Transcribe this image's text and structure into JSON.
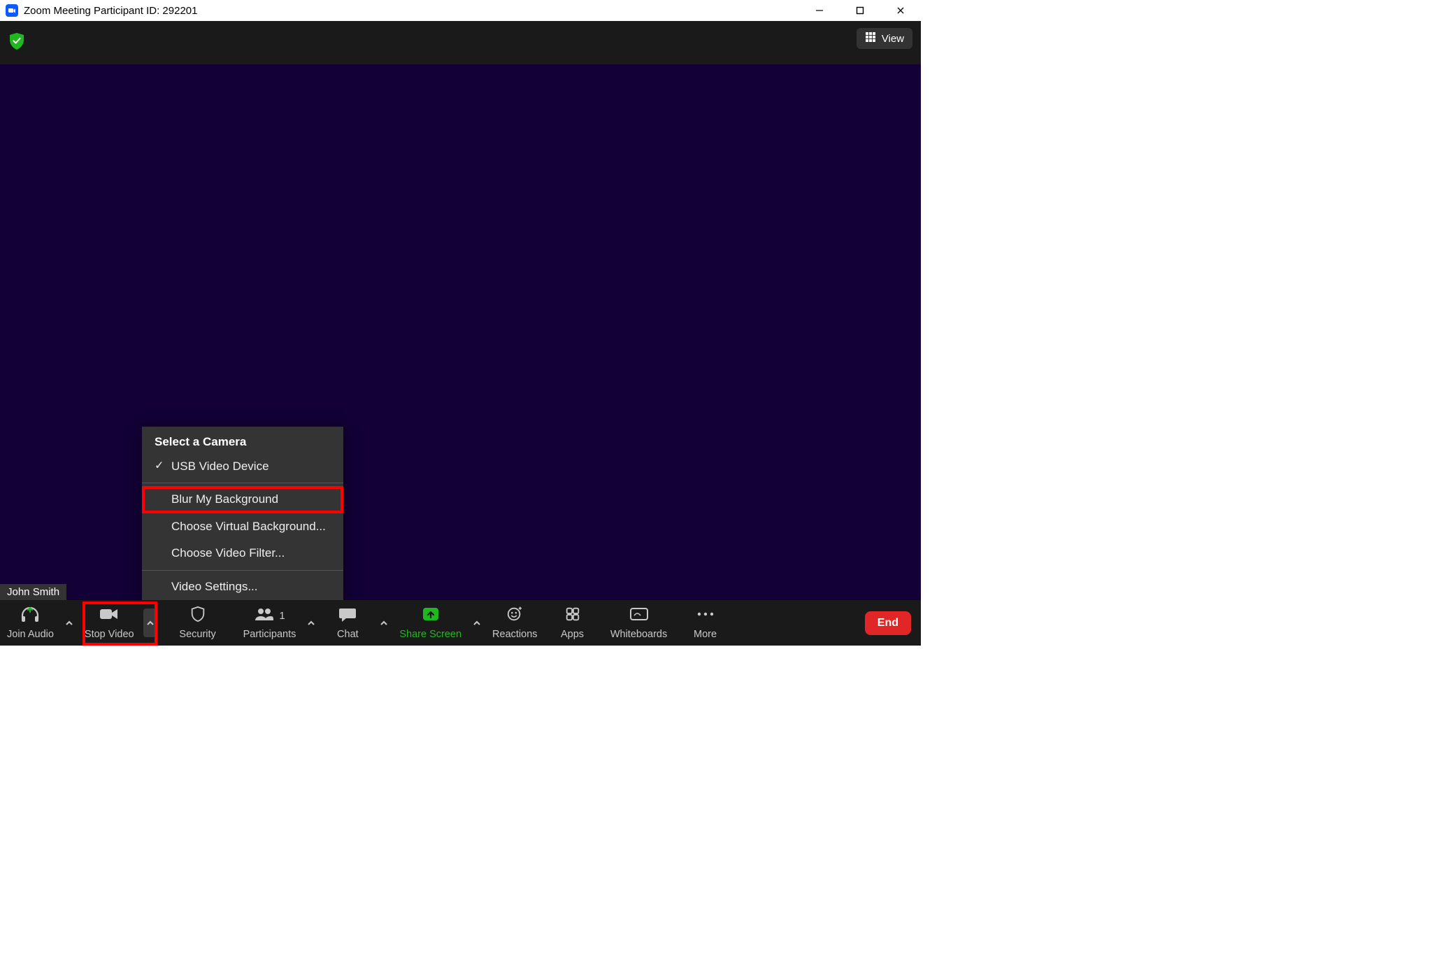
{
  "titlebar": {
    "title": "Zoom Meeting Participant ID: 292201"
  },
  "topstrip": {
    "view_label": "View"
  },
  "video": {
    "name_tag": "John Smith"
  },
  "menu": {
    "header": "Select a Camera",
    "camera": "USB Video Device",
    "blur": "Blur My Background",
    "virtual_bg": "Choose Virtual Background...",
    "filter": "Choose Video Filter...",
    "settings": "Video Settings..."
  },
  "toolbar": {
    "join_audio": "Join Audio",
    "stop_video": "Stop Video",
    "security": "Security",
    "participants": "Participants",
    "participants_count": "1",
    "chat": "Chat",
    "share_screen": "Share Screen",
    "reactions": "Reactions",
    "apps": "Apps",
    "whiteboards": "Whiteboards",
    "more": "More",
    "end": "End"
  }
}
